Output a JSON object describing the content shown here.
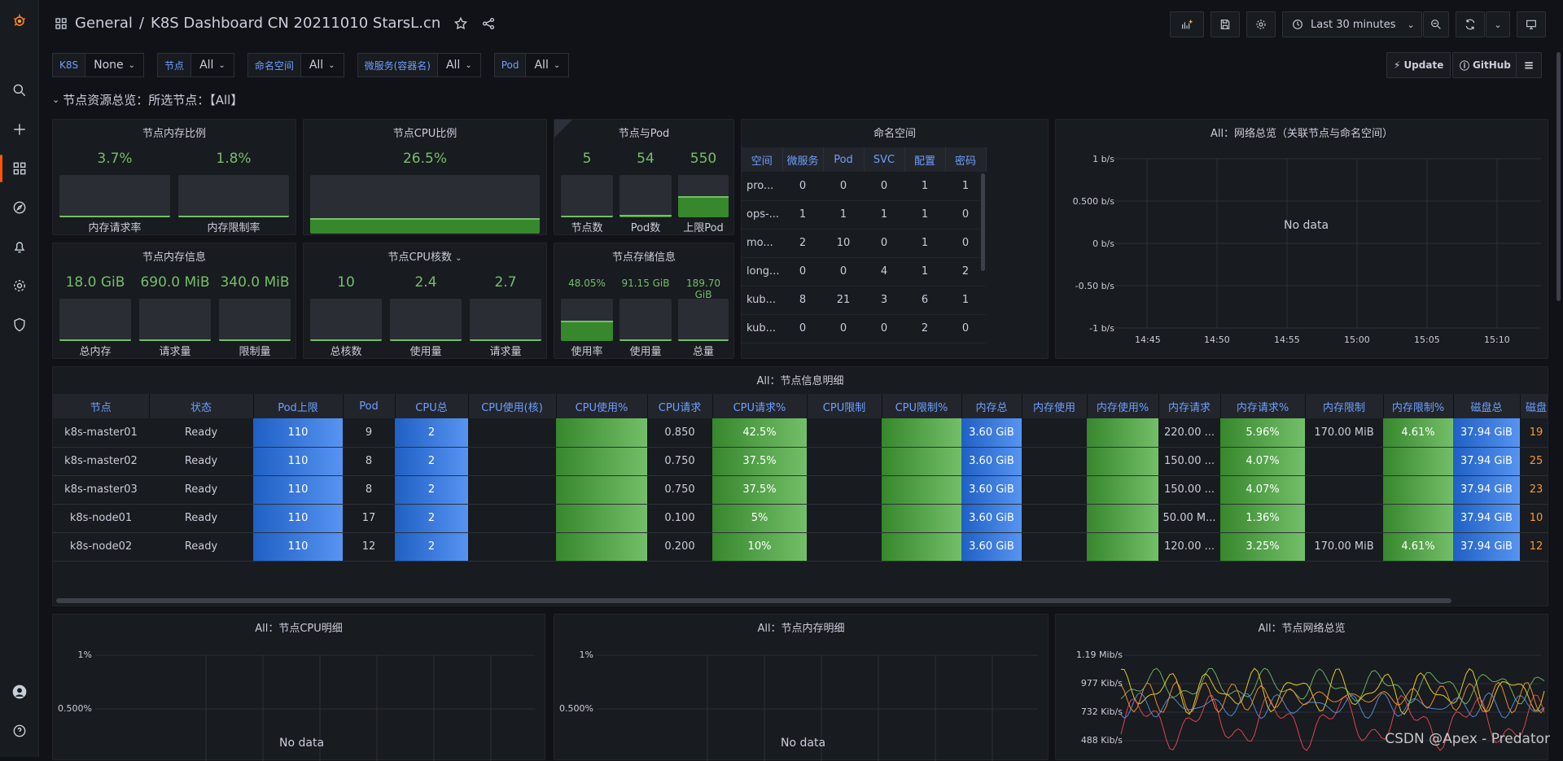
{
  "breadcrumb": {
    "folder": "General",
    "separator": "/",
    "dashboard": "K8S Dashboard CN 20211010 StarsL.cn"
  },
  "toolbar": {
    "time_range": "Last 30 minutes"
  },
  "variables": [
    {
      "label": "K8S",
      "value": "None"
    },
    {
      "label": "节点",
      "value": "All"
    },
    {
      "label": "命名空间",
      "value": "All"
    },
    {
      "label": "微服务(容器名)",
      "value": "All"
    },
    {
      "label": "Pod",
      "value": "All"
    }
  ],
  "links": {
    "update": "Update",
    "github": "GitHub"
  },
  "row": {
    "title": "节点资源总览：所选节点：【All】"
  },
  "colors": {
    "green": "#73bf69",
    "blue": "#5794f2",
    "accent": "#ff5705"
  },
  "mem_ratio": {
    "title": "节点内存比例",
    "gauges": [
      {
        "value": "3.7%",
        "label": "内存请求率",
        "level": 0.037
      },
      {
        "value": "1.8%",
        "label": "内存限制率",
        "level": 0.018
      }
    ]
  },
  "cpu_ratio": {
    "title": "节点CPU比例",
    "gauges": [
      {
        "value": "26.5%",
        "label": "",
        "level": 0.265
      }
    ]
  },
  "node_pod": {
    "title": "节点与Pod",
    "gauges": [
      {
        "value": "5",
        "label": "节点数",
        "level": 0.02
      },
      {
        "value": "54",
        "label": "Pod数",
        "level": 0.05
      },
      {
        "value": "550",
        "label": "上限Pod",
        "level": 0.5
      }
    ]
  },
  "mem_info": {
    "title": "节点内存信息",
    "gauges": [
      {
        "value": "18.0 GiB",
        "label": "总内存",
        "level": 0.02
      },
      {
        "value": "690.0 MiB",
        "label": "请求量",
        "level": 0.02
      },
      {
        "value": "340.0 MiB",
        "label": "限制量",
        "level": 0.02
      }
    ]
  },
  "cpu_cores": {
    "title": "节点CPU核数",
    "gauges": [
      {
        "value": "10",
        "label": "总核数",
        "level": 0.02
      },
      {
        "value": "2.4",
        "label": "使用量",
        "level": 0.02
      },
      {
        "value": "2.7",
        "label": "请求量",
        "level": 0.02
      }
    ]
  },
  "storage": {
    "title": "节点存储信息",
    "gauges": [
      {
        "value": "48.05%",
        "label": "使用率",
        "level": 0.48
      },
      {
        "value": "91.15 GiB",
        "label": "使用量",
        "level": 0.02
      },
      {
        "value": "189.70 GiB",
        "label": "总量",
        "level": 0.02
      }
    ]
  },
  "namespace": {
    "title": "命名空间",
    "headers": [
      "空间",
      "微服务",
      "Pod",
      "SVC",
      "配置",
      "密码"
    ],
    "rows": [
      [
        "pro...",
        "0",
        "0",
        "0",
        "1",
        "1"
      ],
      [
        "ops-...",
        "1",
        "1",
        "1",
        "1",
        "0"
      ],
      [
        "mo...",
        "2",
        "10",
        "0",
        "1",
        "0"
      ],
      [
        "long...",
        "0",
        "0",
        "4",
        "1",
        "2"
      ],
      [
        "kub...",
        "8",
        "21",
        "3",
        "6",
        "1"
      ],
      [
        "kub...",
        "0",
        "0",
        "0",
        "2",
        "0"
      ]
    ]
  },
  "network": {
    "title": "All：网络总览（关联节点与命名空间）",
    "nodata": "No data",
    "y_ticks": [
      "1 b/s",
      "0.500 b/s",
      "0 b/s",
      "-0.50 b/s",
      "-1 b/s"
    ],
    "x_ticks": [
      "14:45",
      "14:50",
      "14:55",
      "15:00",
      "15:05",
      "15:10"
    ]
  },
  "node_detail": {
    "title": "All：节点信息明细",
    "headers": [
      "节点",
      "状态",
      "Pod上限",
      "Pod",
      "CPU总",
      "CPU使用(核)",
      "CPU使用%",
      "CPU请求",
      "CPU请求%",
      "CPU限制",
      "CPU限制%",
      "内存总",
      "内存使用",
      "内存使用%",
      "内存请求",
      "内存请求%",
      "内存限制",
      "内存限制%",
      "磁盘总",
      "磁盘"
    ],
    "rows": [
      [
        "k8s-master01",
        "Ready",
        "110",
        "9",
        "2",
        "",
        "",
        "0.850",
        "42.5%",
        "",
        "",
        "3.60 GiB",
        "",
        "",
        "220.00 ...",
        "5.96%",
        "170.00 MiB",
        "4.61%",
        "37.94 GiB",
        "19"
      ],
      [
        "k8s-master02",
        "Ready",
        "110",
        "8",
        "2",
        "",
        "",
        "0.750",
        "37.5%",
        "",
        "",
        "3.60 GiB",
        "",
        "",
        "150.00 ...",
        "4.07%",
        "",
        "",
        "37.94 GiB",
        "25"
      ],
      [
        "k8s-master03",
        "Ready",
        "110",
        "8",
        "2",
        "",
        "",
        "0.750",
        "37.5%",
        "",
        "",
        "3.60 GiB",
        "",
        "",
        "150.00 ...",
        "4.07%",
        "",
        "",
        "37.94 GiB",
        "23"
      ],
      [
        "k8s-node01",
        "Ready",
        "110",
        "17",
        "2",
        "",
        "",
        "0.100",
        "5%",
        "",
        "",
        "3.60 GiB",
        "",
        "",
        "50.00 M...",
        "1.36%",
        "",
        "",
        "37.94 GiB",
        "10"
      ],
      [
        "k8s-node02",
        "Ready",
        "110",
        "12",
        "2",
        "",
        "",
        "0.200",
        "10%",
        "",
        "",
        "3.60 GiB",
        "",
        "",
        "120.00 ...",
        "3.25%",
        "170.00 MiB",
        "4.61%",
        "37.94 GiB",
        "12"
      ]
    ]
  },
  "cpu_detail": {
    "title": "All：节点CPU明细",
    "y_ticks": [
      "1%",
      "0.500%"
    ],
    "nodata": "No data"
  },
  "mem_detail": {
    "title": "All：节点内存明细",
    "y_ticks": [
      "1%",
      "0.500%"
    ],
    "nodata": "No data"
  },
  "net_overview": {
    "title": "All：节点网络总览",
    "y_ticks": [
      "1.19 Mib/s",
      "977 Kib/s",
      "732 Kib/s",
      "488 Kib/s"
    ]
  },
  "watermark": "CSDN @Apex - Predator"
}
